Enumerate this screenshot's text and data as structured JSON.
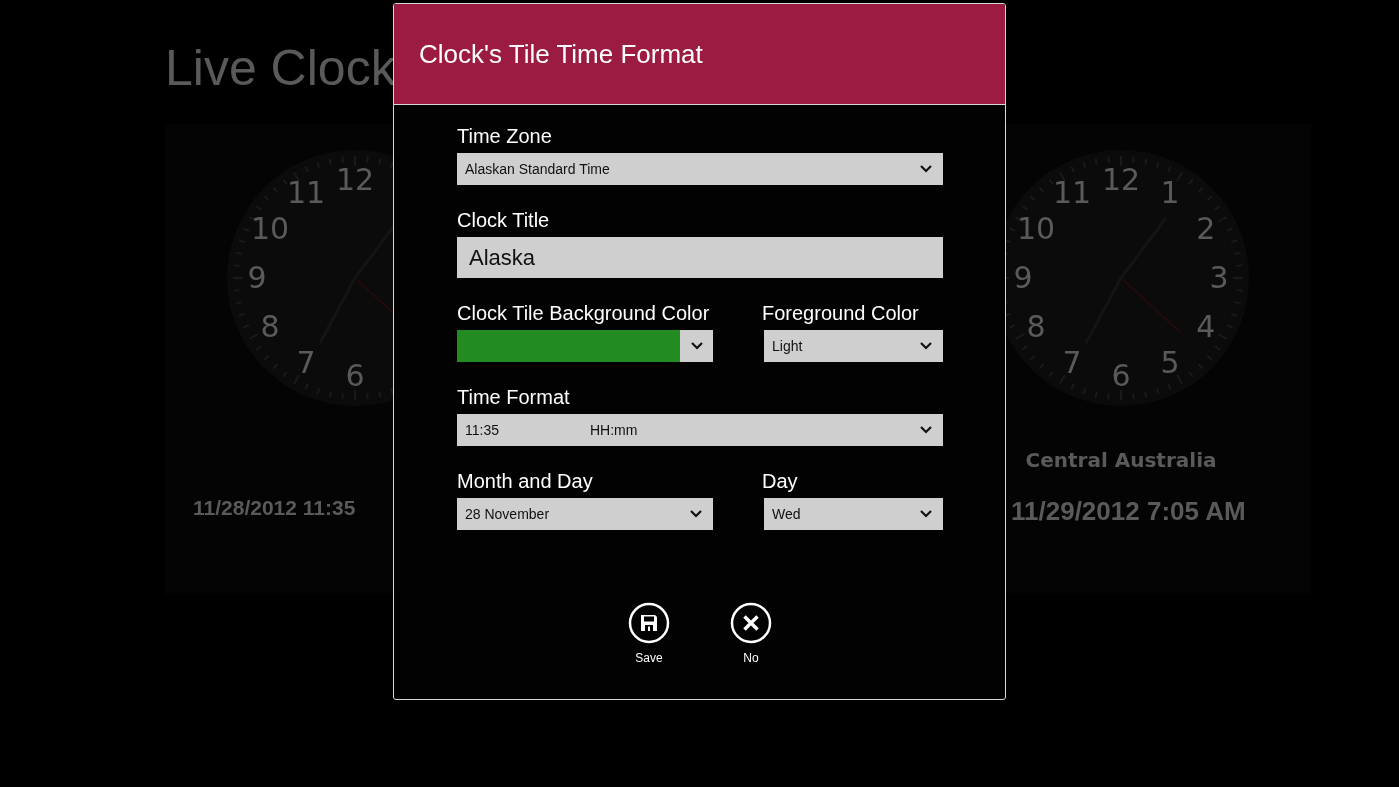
{
  "background": {
    "app_title": "Live Clock",
    "clocks": [
      {
        "dial_numbers": [
          "11",
          "12",
          "10",
          "9",
          "8",
          "7",
          "6"
        ],
        "date": "11/28/2012 11:35"
      },
      {
        "dial_numbers": [
          "11",
          "12",
          "1",
          "10",
          "2",
          "9",
          "3",
          "8",
          "4",
          "7",
          "6",
          "5"
        ],
        "location": "Central Australia",
        "date": "11/29/2012 7:05 AM"
      }
    ]
  },
  "dialog": {
    "title": "Clock's Tile Time Format",
    "rows": [
      [
        {
          "kind": "dropdown",
          "label": "Time Zone",
          "value": "Alaskan Standard Time"
        }
      ],
      [
        {
          "kind": "text",
          "label": "Clock Title",
          "value": "Alaska"
        }
      ],
      [
        {
          "kind": "color",
          "label": "Clock Tile Background Color",
          "color": "#228b22"
        },
        {
          "kind": "dropdown",
          "label": "Foreground Color",
          "value": "Light"
        }
      ],
      [
        {
          "kind": "format",
          "label": "Time Format",
          "sample": "11:35",
          "pattern": "HH:mm"
        }
      ],
      [
        {
          "kind": "dropdown",
          "label": "Month and Day",
          "value": "28 November"
        },
        {
          "kind": "dropdown",
          "label": "Day",
          "value": "Wed"
        }
      ]
    ],
    "buttons": [
      {
        "label": "Save"
      },
      {
        "label": "No"
      }
    ]
  }
}
